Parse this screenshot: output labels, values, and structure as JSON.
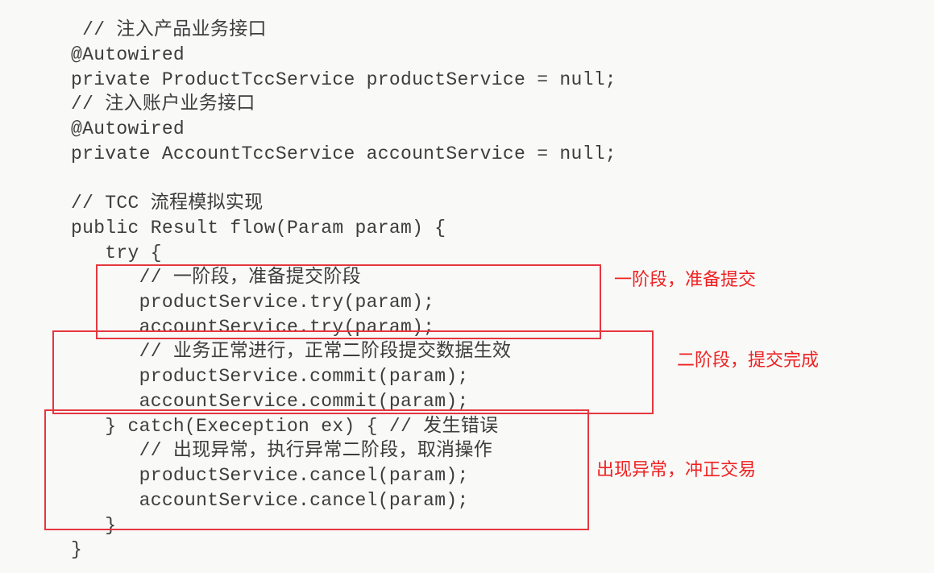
{
  "code": {
    "lines": [
      " // 注入产品业务接口",
      "@Autowired",
      "private ProductTccService productService = null;",
      "// 注入账户业务接口",
      "@Autowired",
      "private AccountTccService accountService = null;",
      "",
      "// TCC 流程模拟实现",
      "public Result flow(Param param) {",
      "   try {",
      "      // 一阶段，准备提交阶段",
      "      productService.try(param);",
      "      accountService.try(param);",
      "      // 业务正常进行，正常二阶段提交数据生效",
      "      productService.commit(param);",
      "      accountService.commit(param);",
      "   } catch(Exeception ex) { // 发生错误",
      "      // 出现异常，执行异常二阶段，取消操作",
      "      productService.cancel(param);",
      "      accountService.cancel(param);",
      "   }",
      "}"
    ]
  },
  "annotations": {
    "phase1": "一阶段，准备提交",
    "phase2": "二阶段，提交完成",
    "exception": "出现异常，冲正交易"
  },
  "colors": {
    "highlight": "#e5373f",
    "annotation_text": "#ee2222",
    "code_text": "#3d3d3d"
  }
}
